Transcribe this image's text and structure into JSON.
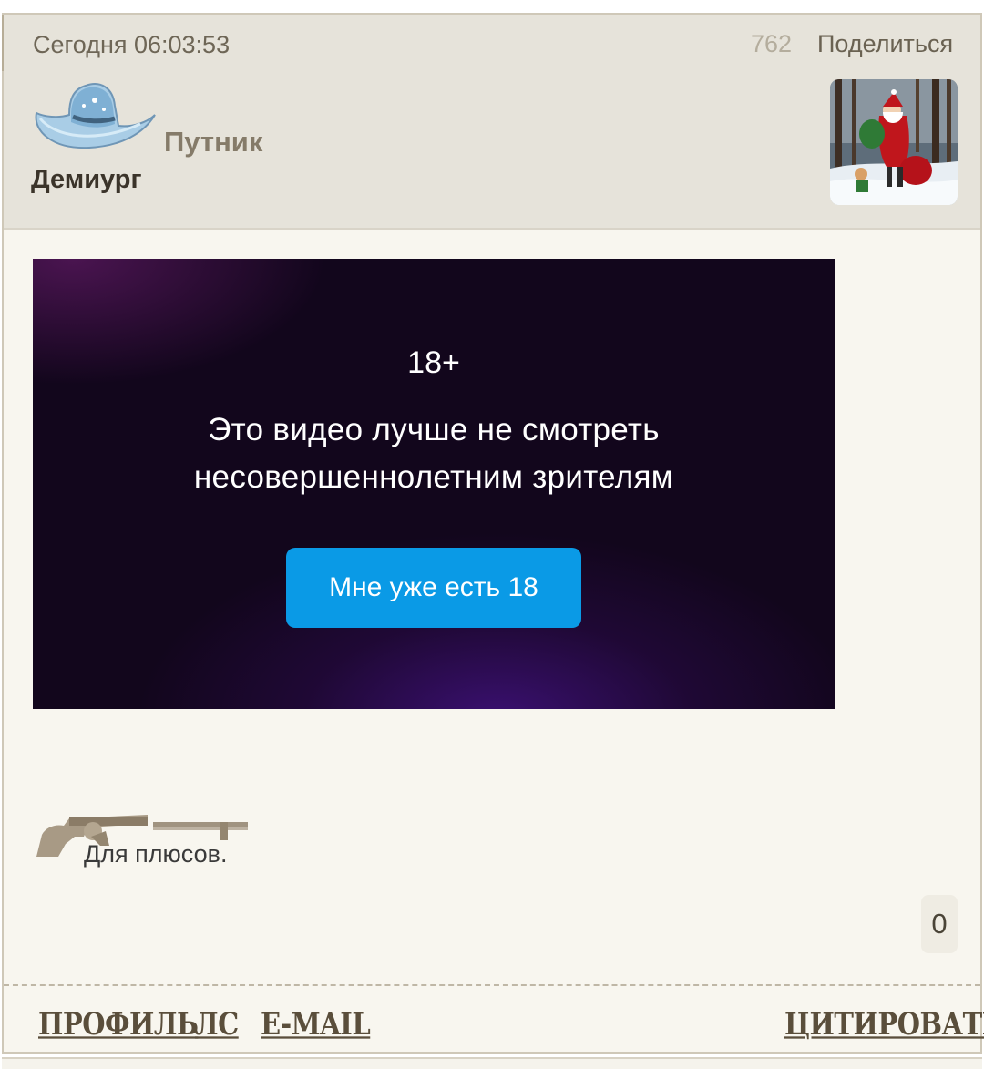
{
  "post": {
    "date": "Сегодня 06:03:53",
    "views": "762",
    "share_label": "Поделиться",
    "author": {
      "username": "Путник",
      "rank": "Демиург"
    }
  },
  "video": {
    "age_badge": "18+",
    "warning_line1": "Это видео лучше не смотреть",
    "warning_line2": "несовершеннолетним зрителям",
    "confirm_button": "Мне уже есть 18",
    "button_color": "#0a9ae6"
  },
  "signature": {
    "text": "Для плюсов."
  },
  "rating": {
    "count": "0"
  },
  "footer": {
    "profile": "ПРОФИЛЬ",
    "pm": "ЛС",
    "email": "E-MAIL",
    "quote": "ЦИТИРОВАТЬ"
  }
}
